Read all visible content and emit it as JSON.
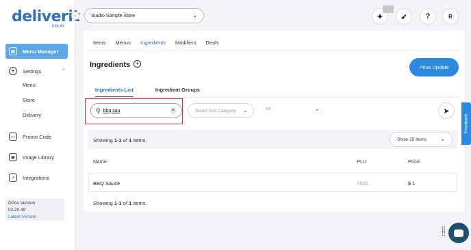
{
  "app": {
    "logo": "deliverit",
    "logo_sub": "COLIO"
  },
  "sidebar": {
    "items": [
      {
        "label": "Menu Manager",
        "icon": "menu-manager-icon"
      },
      {
        "label": "Settings",
        "icon": "gear-icon"
      },
      {
        "label": "Promo Code",
        "icon": "promo-icon"
      },
      {
        "label": "Image Library",
        "icon": "image-icon"
      },
      {
        "label": "Integrations",
        "icon": "integrations-icon"
      }
    ],
    "settings_sub": [
      "Menu",
      "Store",
      "Delivery"
    ],
    "version_label": "DPos Version",
    "version_number": "02.20.49",
    "latest_version": "Latest Version"
  },
  "topbar": {
    "store": "Studio Sample Store",
    "help": "?",
    "avatar": "R"
  },
  "tabs": [
    "Items",
    "Menus",
    "Ingredients",
    "Modifiers",
    "Deals"
  ],
  "active_tab": "Ingredients",
  "page": {
    "title": "Ingredients",
    "price_update": "Price Update"
  },
  "subtabs": [
    "Ingredients List",
    "Ingredient Groups"
  ],
  "filters": {
    "search_value": "bbq sau",
    "subcategory_placeholder": "Select Sub Category",
    "all": "All"
  },
  "pagination": {
    "showing_prefix": "Showing ",
    "showing_range": "1-1",
    "showing_of": " of ",
    "showing_total": "1",
    "showing_suffix": " items.",
    "page_size": "Show 25 Items"
  },
  "table": {
    "headers": [
      "Name",
      "PLU",
      "Price"
    ],
    "rows": [
      {
        "name": "BBQ Sauce",
        "plu": "T001",
        "price": "$ 1"
      }
    ]
  },
  "feedback": "Feedback",
  "colors": {
    "accent": "#2b8ae0",
    "sidebar_active": "#5aa9e6",
    "highlight": "#e0272c"
  }
}
